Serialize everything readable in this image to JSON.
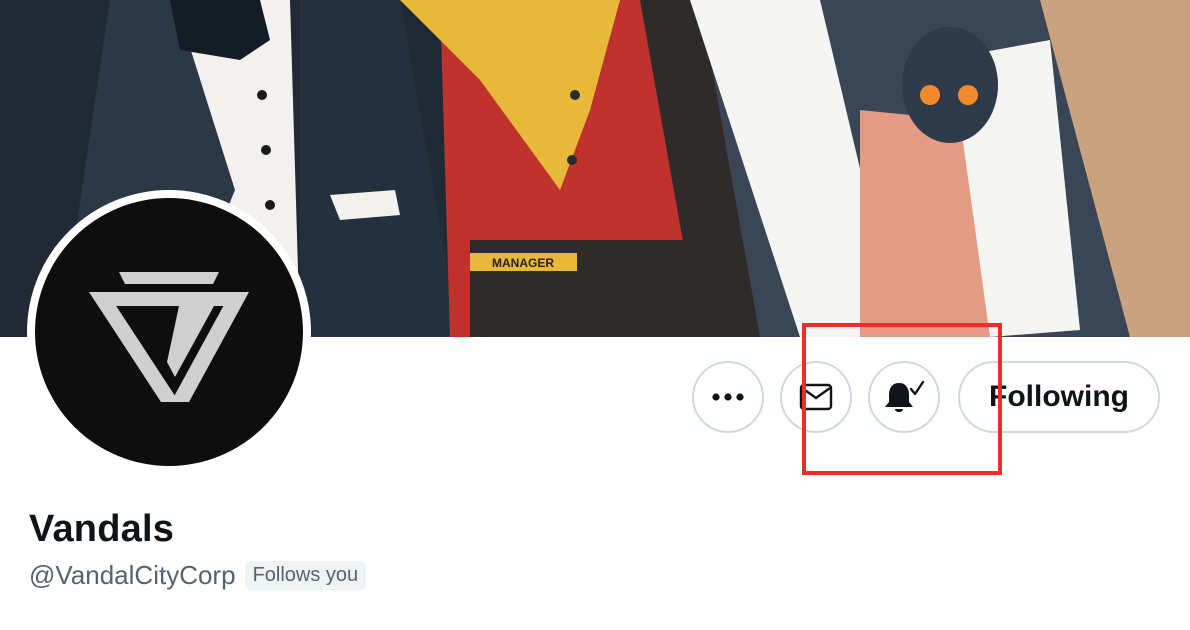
{
  "banner": {
    "apron_badge_text": "MANAGER"
  },
  "profile": {
    "display_name": "Vandals",
    "handle": "@VandalCityCorp",
    "follows_you_label": "Follows you"
  },
  "actions": {
    "more_icon": "more-horizontal-icon",
    "message_icon": "envelope-icon",
    "notifications_icon": "bell-check-icon",
    "following_label": "Following"
  },
  "colors": {
    "text_primary": "#0f1419",
    "text_secondary": "#536471",
    "button_border": "#cfd9de",
    "badge_bg": "#eff3f4",
    "highlight": "#e8302a"
  }
}
